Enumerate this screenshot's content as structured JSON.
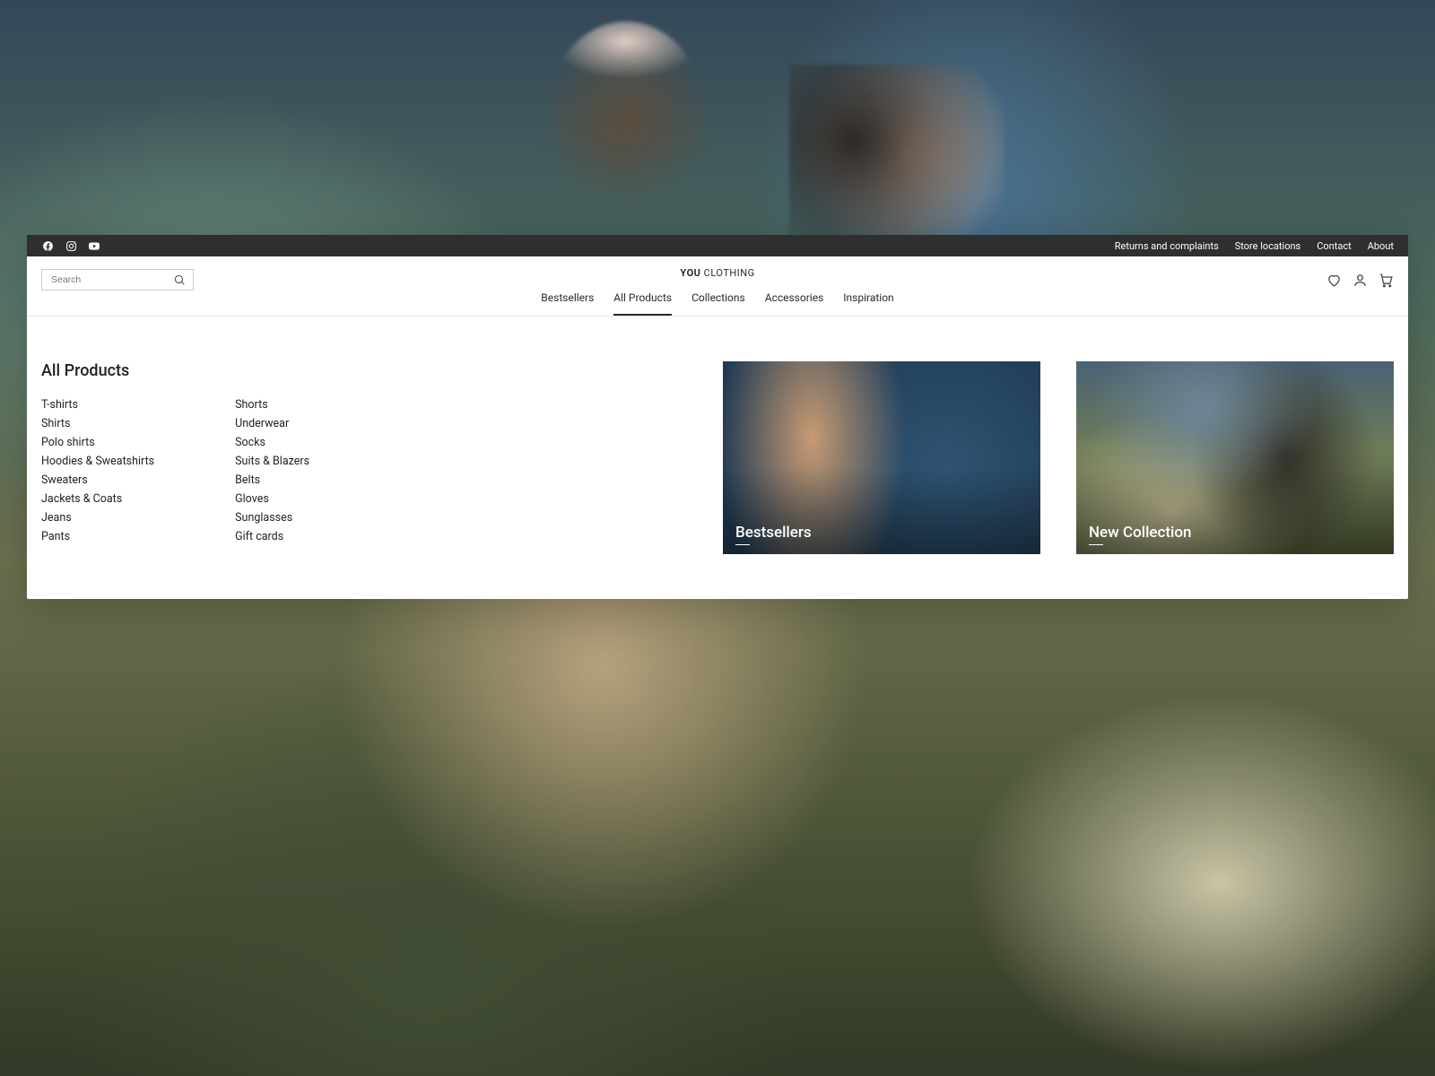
{
  "topbar": {
    "links": [
      "Returns and complaints",
      "Store locations",
      "Contact",
      "About"
    ]
  },
  "logo": {
    "bold": "YOU",
    "light": "CLOTHING"
  },
  "search": {
    "placeholder": "Search"
  },
  "nav": {
    "items": [
      "Bestsellers",
      "All Products",
      "Collections",
      "Accessories",
      "Inspiration"
    ],
    "activeIndex": 1
  },
  "mega": {
    "title": "All Products",
    "list1": [
      "T-shirts",
      "Shirts",
      "Polo shirts",
      "Hoodies & Sweatshirts",
      "Sweaters",
      "Jackets & Coats",
      "Jeans",
      "Pants"
    ],
    "list2": [
      "Shorts",
      "Underwear",
      "Socks",
      "Suits & Blazers",
      "Belts",
      "Gloves",
      "Sunglasses",
      "Gift cards"
    ],
    "card1": "Bestsellers",
    "card2": "New Collection"
  }
}
